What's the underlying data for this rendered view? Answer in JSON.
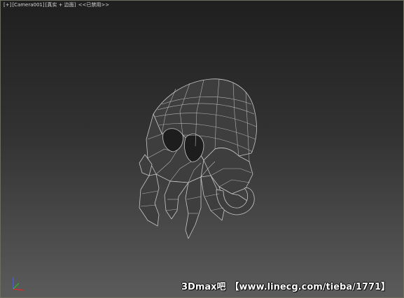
{
  "viewport": {
    "label": {
      "view_menu": "[+]",
      "camera": "[Camera001]",
      "shading": "[真实 + 边面]",
      "status": "<<已禁用>>"
    },
    "background_top": "#1f1f1f",
    "background_bottom": "#5b5b5b",
    "border_color": "#6e6e5e"
  },
  "model": {
    "icon": "octopus-skull-wireframe-mesh",
    "wire_color": "#c8c8c8",
    "fill_color": "#3e3e3e"
  },
  "axis_gizmo": {
    "icon": "xyz-axis-icon",
    "x_color": "#d03030",
    "y_color": "#30b030",
    "z_color": "#4060e0"
  },
  "watermark": {
    "brand": "3Dmax吧",
    "url": "【www.linecg.com/tieba/1771】"
  }
}
